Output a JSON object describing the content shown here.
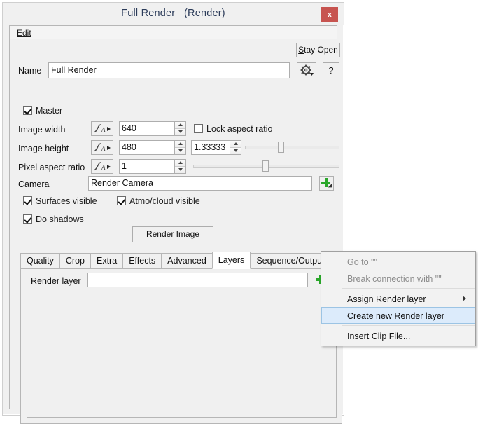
{
  "window": {
    "title": "Full Render   (Render)",
    "close_label": "x",
    "menu": {
      "edit": "Edit",
      "edit_mnemonic": "E"
    }
  },
  "toolbar": {
    "stay_open_label": "Stay Open",
    "stay_open_mnemonic": "S",
    "gear_icon": "gear-icon",
    "help_label": "?"
  },
  "form": {
    "name_label": "Name",
    "name_value": "Full Render",
    "master_label": "Master",
    "master_checked": true,
    "image_width_label": "Image width",
    "image_width_value": "640",
    "lock_aspect_label": "Lock aspect ratio",
    "lock_aspect_checked": false,
    "image_height_label": "Image height",
    "image_height_value": "480",
    "aspect_value": "1.33333",
    "pixel_aspect_label": "Pixel aspect ratio",
    "pixel_aspect_value": "1",
    "camera_label": "Camera",
    "camera_value": "Render Camera",
    "surfaces_visible_label": "Surfaces visible",
    "surfaces_visible_checked": true,
    "atmo_visible_label": "Atmo/cloud visible",
    "atmo_visible_checked": true,
    "do_shadows_label": "Do shadows",
    "do_shadows_checked": true,
    "render_image_label": "Render Image"
  },
  "tabs": [
    {
      "label": "Quality",
      "active": false
    },
    {
      "label": "Crop",
      "active": false
    },
    {
      "label": "Extra",
      "active": false
    },
    {
      "label": "Effects",
      "active": false
    },
    {
      "label": "Advanced",
      "active": false
    },
    {
      "label": "Layers",
      "active": true
    },
    {
      "label": "Sequence/Output",
      "active": false
    }
  ],
  "layers_panel": {
    "render_layer_label": "Render layer",
    "render_layer_value": "",
    "render_layer_placeholder": "",
    "add_icon": "green-plus-icon"
  },
  "context_menu": {
    "items": [
      {
        "label": "Go to \"\"",
        "disabled": true,
        "highlight": false,
        "submenu": false
      },
      {
        "label": "Break connection with \"\"",
        "disabled": true,
        "highlight": false,
        "submenu": false
      },
      {
        "separator": true
      },
      {
        "label": "Assign Render layer",
        "disabled": false,
        "highlight": false,
        "submenu": true
      },
      {
        "label": "Create new Render layer",
        "disabled": false,
        "highlight": true,
        "submenu": false
      },
      {
        "separator": true
      },
      {
        "label": "Insert Clip File...",
        "disabled": false,
        "highlight": false,
        "submenu": false
      }
    ]
  },
  "colors": {
    "window_bg": "#f0f0f0",
    "close_red": "#c75450",
    "title_text": "#2c3c5a",
    "accent_green": "#2aa72a",
    "menu_highlight_bg": "#dcebfb",
    "menu_highlight_border": "#9cc4e4"
  }
}
